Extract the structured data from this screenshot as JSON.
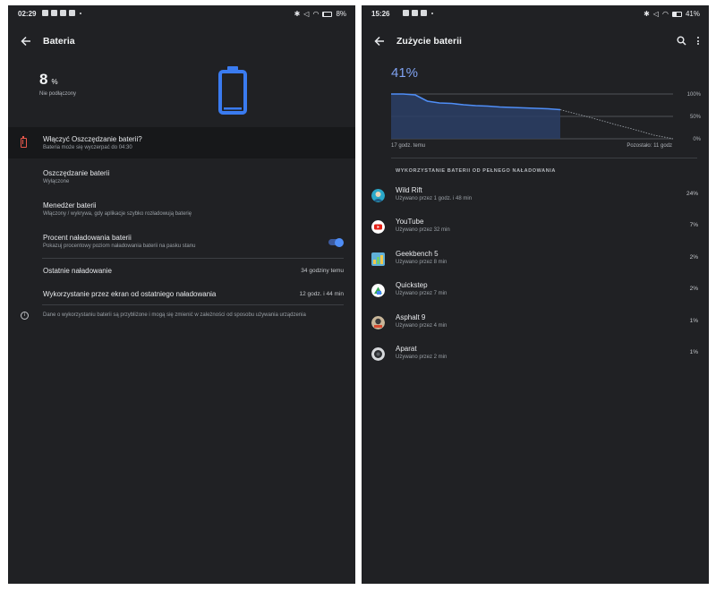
{
  "left": {
    "status": {
      "time": "02:29",
      "battery": "8%"
    },
    "toolbar": {
      "title": "Bateria"
    },
    "level": {
      "value": "8",
      "unit": "%",
      "state": "Nie podłączony"
    },
    "saver_banner": {
      "title": "Włączyć Oszczędzanie baterii?",
      "subtitle": "Bateria może się wyczerpać do 04:30"
    },
    "items": [
      {
        "title": "Oszczędzanie baterii",
        "subtitle": "Wyłączone"
      },
      {
        "title": "Menedżer baterii",
        "subtitle": "Włączony / wykrywa, gdy aplikacje szybko rozładowują baterię"
      },
      {
        "title": "Procent naładowania baterii",
        "subtitle": "Pokazuj procentowy poziom naładowania baterii na pasku stanu"
      }
    ],
    "stats": [
      {
        "label": "Ostatnie naładowanie",
        "value": "34 godziny temu"
      },
      {
        "label": "Wykorzystanie przez ekran od ostatniego naładowania",
        "value": "12 godz. i 44 min"
      }
    ],
    "info": "Dane o wykorzystaniu baterii są przybliżone i mogą się zmienić w zależności od sposobu używania urządzenia",
    "toggle_on": true
  },
  "right": {
    "status": {
      "time": "15:26",
      "battery": "41%"
    },
    "toolbar": {
      "title": "Zużycie baterii"
    },
    "level": "41%",
    "chart_labels": {
      "left": "17 godz. temu",
      "right": "Pozostało: 11 godz"
    },
    "section_title": "WYKORZYSTANIE BATERII OD PEŁNEGO NAŁADOWANIA",
    "apps": [
      {
        "name": "Wild Rift",
        "usage": "Używano przez 1 godz. i 48 min",
        "pct": "24%",
        "icon": "wild-rift-icon"
      },
      {
        "name": "YouTube",
        "usage": "Używano przez 32 min",
        "pct": "7%",
        "icon": "youtube-icon"
      },
      {
        "name": "Geekbench 5",
        "usage": "Używano przez 8 min",
        "pct": "2%",
        "icon": "geekbench-icon"
      },
      {
        "name": "Quickstep",
        "usage": "Używano przez 7 min",
        "pct": "2%",
        "icon": "quickstep-icon"
      },
      {
        "name": "Asphalt 9",
        "usage": "Używano przez 4 min",
        "pct": "1%",
        "icon": "asphalt-icon"
      },
      {
        "name": "Aparat",
        "usage": "Używano przez 2 min",
        "pct": "1%",
        "icon": "camera-icon"
      }
    ]
  },
  "chart_data": {
    "type": "area",
    "y_tick_labels": [
      "100%",
      "50%",
      "0%"
    ],
    "ylim": [
      0,
      100
    ],
    "series": [
      {
        "values": [
          100,
          100,
          98,
          84,
          80,
          79,
          76,
          74,
          73,
          71,
          70,
          69,
          68,
          67,
          65
        ]
      },
      {
        "values": [
          65,
          54,
          43,
          31,
          20,
          8,
          0
        ]
      }
    ]
  },
  "colors": {
    "accent": "#4f8ef7",
    "warning": "#e8584c",
    "panel_bg": "#202124"
  }
}
